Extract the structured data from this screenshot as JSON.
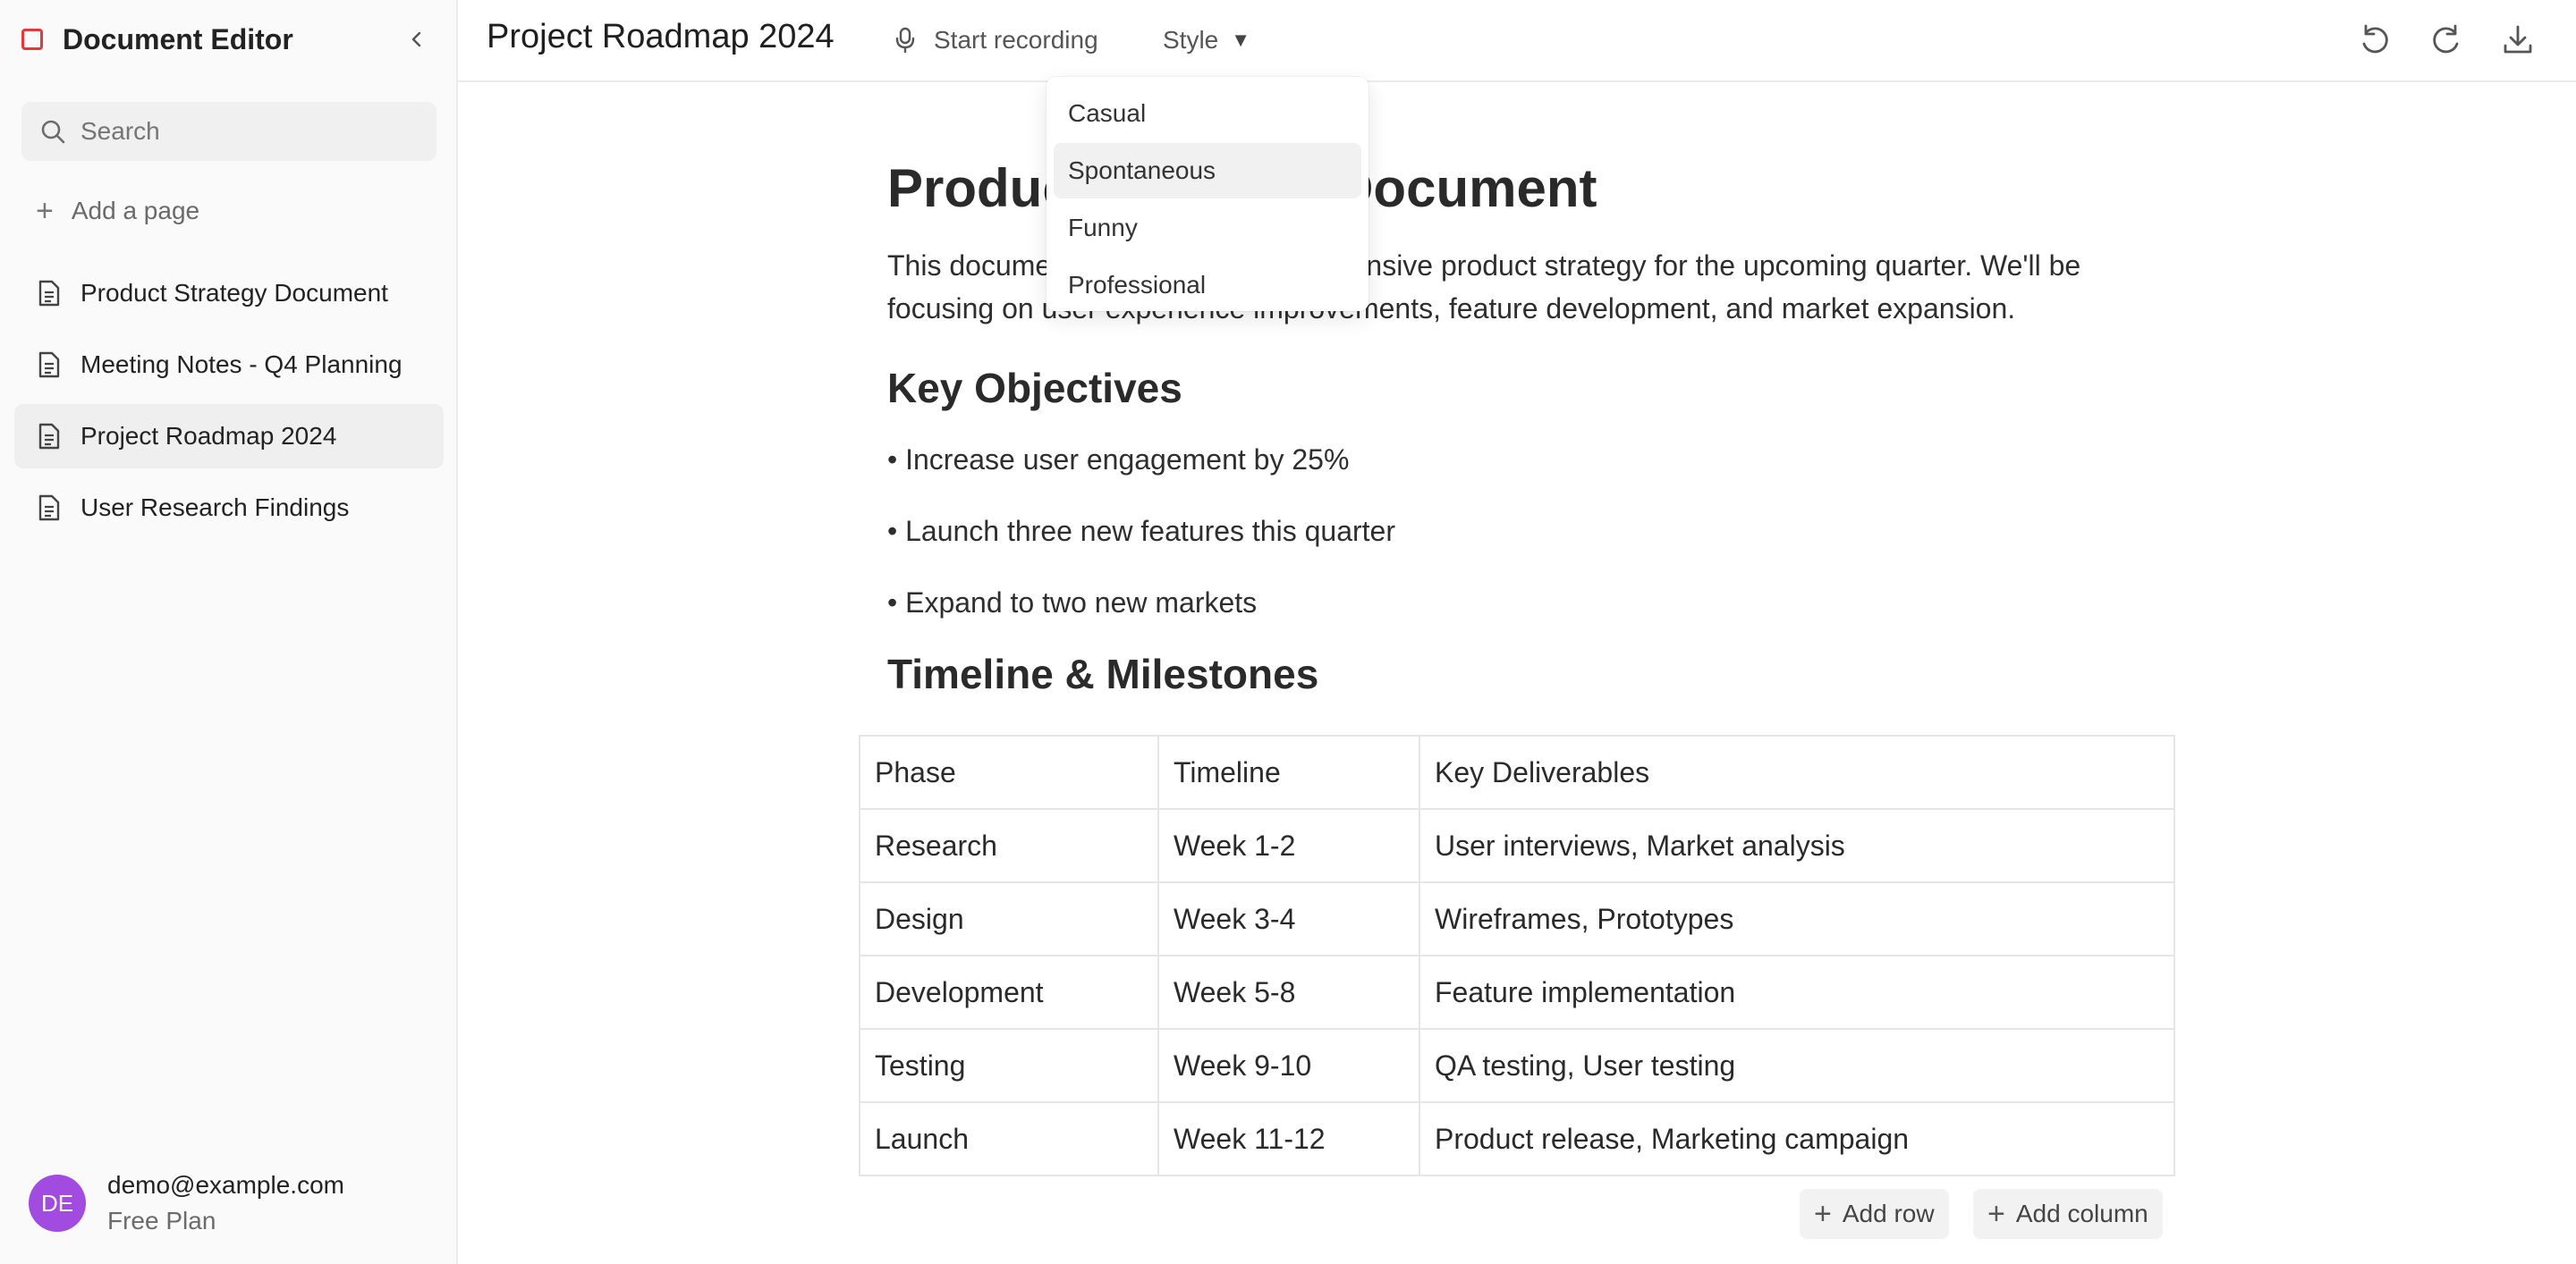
{
  "sidebar": {
    "app_title": "Document Editor",
    "search": {
      "placeholder": "Search"
    },
    "add_page_label": "Add a page",
    "pages": [
      {
        "label": "Product Strategy Document"
      },
      {
        "label": "Meeting Notes - Q4 Planning"
      },
      {
        "label": "Project Roadmap 2024",
        "active": true
      },
      {
        "label": "User Research Findings"
      }
    ],
    "user": {
      "initials": "DE",
      "email": "demo@example.com",
      "plan": "Free Plan"
    }
  },
  "topbar": {
    "doc_title": "Project Roadmap 2024",
    "record_label": "Start recording",
    "style_label": "Style",
    "style_caret": "▼"
  },
  "style_menu": {
    "options": [
      "Casual",
      "Spontaneous",
      "Funny",
      "Professional"
    ],
    "highlighted": "Spontaneous"
  },
  "document": {
    "heading": "Product Strategy Document",
    "intro": "This document outlines our comprehensive product strategy for the upcoming quarter. We'll be focusing on user experience improvements, feature development, and market expansion.",
    "objectives_heading": "Key Objectives",
    "objectives": [
      "• Increase user engagement by 25%",
      "• Launch three new features this quarter",
      "• Expand to two new markets"
    ],
    "timeline_heading": "Timeline & Milestones",
    "table": {
      "headers": [
        "Phase",
        "Timeline",
        "Key Deliverables"
      ],
      "rows": [
        [
          "Research",
          "Week 1-2",
          "User interviews, Market analysis"
        ],
        [
          "Design",
          "Week 3-4",
          "Wireframes, Prototypes"
        ],
        [
          "Development",
          "Week 5-8",
          "Feature implementation"
        ],
        [
          "Testing",
          "Week 9-10",
          "QA testing, User testing"
        ],
        [
          "Launch",
          "Week 11-12",
          "Product release, Marketing campaign"
        ]
      ]
    },
    "add_row_label": "Add row",
    "add_column_label": "Add column"
  },
  "colors": {
    "logo": "#e03a3a",
    "avatar": "#a24be0"
  }
}
